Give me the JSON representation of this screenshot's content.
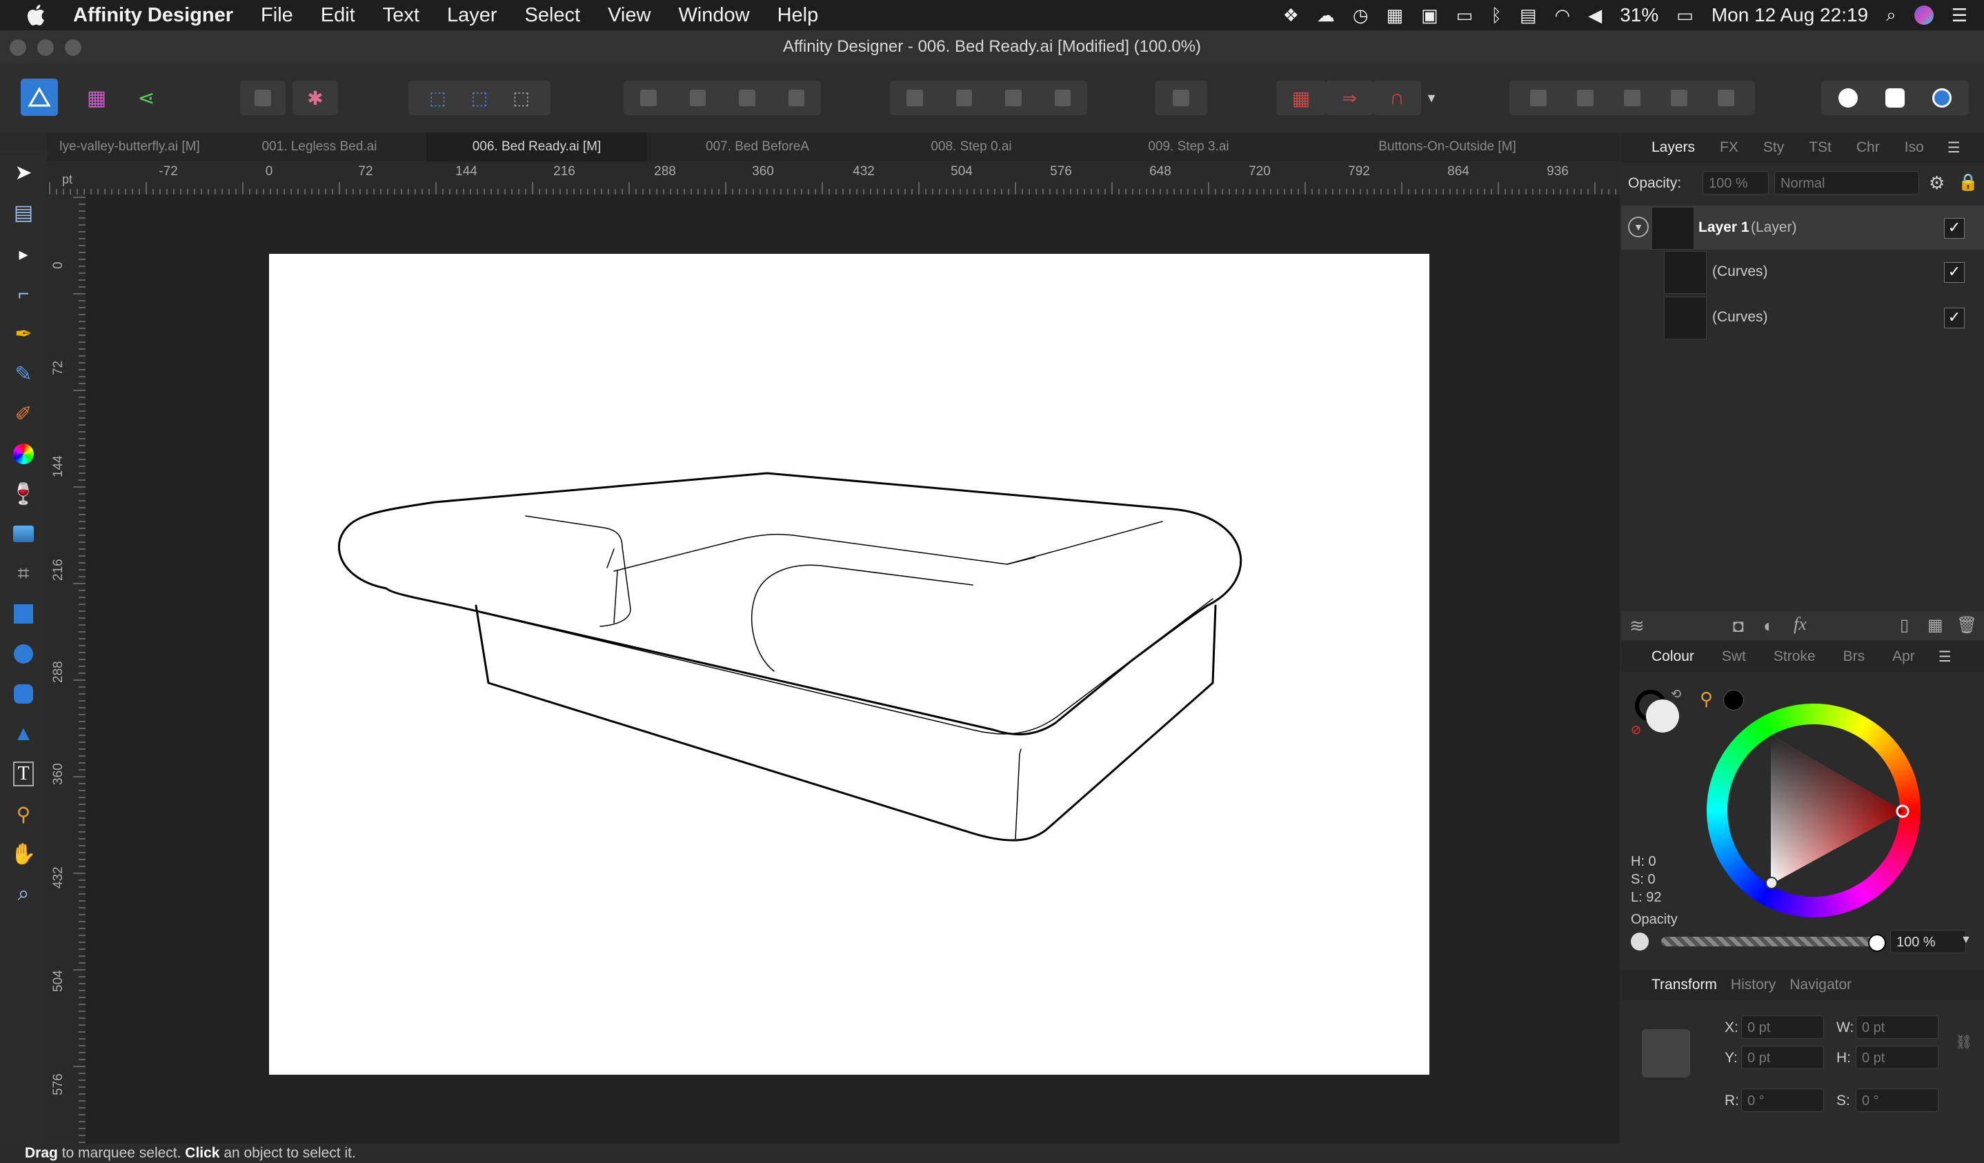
{
  "menubar": {
    "app_name": "Affinity Designer",
    "items": [
      "File",
      "Edit",
      "Text",
      "Layer",
      "Select",
      "View",
      "Window",
      "Help"
    ],
    "battery": "31%",
    "datetime": "Mon 12 Aug  22:19"
  },
  "window": {
    "title": "Affinity Designer - 006. Bed Ready.ai [Modified] (100.0%)"
  },
  "doc_tabs": [
    {
      "label": "lye-valley-butterfly.ai [M]",
      "active": false
    },
    {
      "label": "001. Legless Bed.ai",
      "active": false
    },
    {
      "label": "006. Bed Ready.ai [M]",
      "active": true
    },
    {
      "label": "007. Bed BeforeA",
      "active": false
    },
    {
      "label": "008. Step 0.ai",
      "active": false
    },
    {
      "label": "009. Step 3.ai",
      "active": false
    },
    {
      "label": "Buttons-On-Outside [M]",
      "active": false
    }
  ],
  "ruler": {
    "units": "pt",
    "h_ticks": [
      "-72",
      "0",
      "72",
      "144",
      "216",
      "288",
      "360",
      "432",
      "504",
      "576",
      "648",
      "720",
      "792",
      "864",
      "936"
    ],
    "v_ticks": [
      "0",
      "72",
      "144",
      "216",
      "288",
      "360",
      "432",
      "504",
      "576"
    ]
  },
  "layers_panel": {
    "tabs": [
      "Layers",
      "FX",
      "Sty",
      "TSt",
      "Chr",
      "Iso"
    ],
    "opacity_label": "Opacity:",
    "opacity_value": "100 %",
    "blend_mode": "Normal",
    "layers": [
      {
        "name": "Layer 1",
        "type": "(Layer)",
        "visible": true
      },
      {
        "name": "(Curves)",
        "type": "",
        "visible": true
      },
      {
        "name": "(Curves)",
        "type": "",
        "visible": true
      }
    ]
  },
  "colour_panel": {
    "tabs": [
      "Colour",
      "Swt",
      "Stroke",
      "Brs",
      "Apr"
    ],
    "h": "H: 0",
    "s": "S: 0",
    "l": "L: 92",
    "opacity_label": "Opacity",
    "opacity_value": "100 %"
  },
  "transform_panel": {
    "tabs": [
      "Transform",
      "History",
      "Navigator"
    ],
    "x_label": "X:",
    "x_value": "0 pt",
    "y_label": "Y:",
    "y_value": "0 pt",
    "w_label": "W:",
    "w_value": "0 pt",
    "h_label": "H:",
    "h_value": "0 pt",
    "r_label": "R:",
    "r_value": "0 °",
    "s_label": "S:",
    "s_value": "0 °"
  },
  "statusbar": {
    "drag": "Drag",
    "drag_text": " to marquee select. ",
    "click": "Click",
    "click_text": " an object to select it."
  },
  "colors": {
    "accent": "#2f7cd6",
    "panel": "#2b2b2b",
    "canvas": "#222222"
  }
}
